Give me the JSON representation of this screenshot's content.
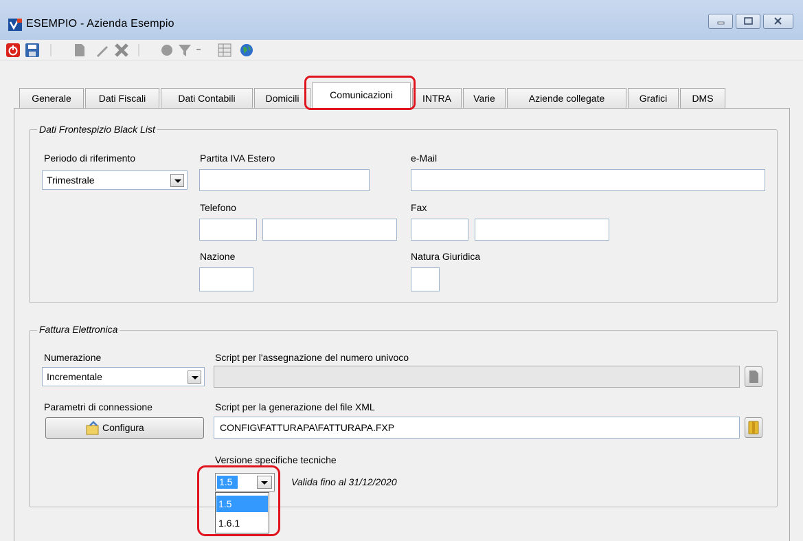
{
  "window": {
    "title": "ESEMPIO - Azienda Esempio"
  },
  "tabs": [
    {
      "label": "Generale"
    },
    {
      "label": "Dati Fiscali"
    },
    {
      "label": "Dati Contabili"
    },
    {
      "label": "Domicili"
    },
    {
      "label": "Comunicazioni"
    },
    {
      "label": "INTRA"
    },
    {
      "label": "Varie"
    },
    {
      "label": "Aziende collegate"
    },
    {
      "label": "Grafici"
    },
    {
      "label": "DMS"
    }
  ],
  "active_tab": "Comunicazioni",
  "black_list": {
    "legend": "Dati Frontespizio Black List",
    "periodo_label": "Periodo di riferimento",
    "periodo_value": "Trimestrale",
    "partita_iva_label": "Partita IVA Estero",
    "partita_iva_value": "",
    "email_label": "e-Mail",
    "email_value": "",
    "telefono_label": "Telefono",
    "fax_label": "Fax",
    "nazione_label": "Nazione",
    "natura_label": "Natura Giuridica"
  },
  "fattura": {
    "legend": "Fattura Elettronica",
    "numerazione_label": "Numerazione",
    "numerazione_value": "Incrementale",
    "script_numero_label": "Script per l'assegnazione del numero univoco",
    "script_numero_value": "",
    "parametri_label": "Parametri di connessione",
    "configura_label": "Configura",
    "script_xml_label": "Script per la generazione del file XML",
    "script_xml_value": "CONFIG\\FATTURAPA\\FATTURAPA.FXP",
    "versione_label": "Versione specifiche tecniche",
    "versione_value": "1.5",
    "versione_options": [
      "1.5",
      "1.6.1"
    ],
    "validita_text": "Valida fino al 31/12/2020"
  },
  "colors": {
    "highlight": "#e0141e",
    "selection": "#3399ff",
    "titlebar": "#c9d9ef"
  }
}
